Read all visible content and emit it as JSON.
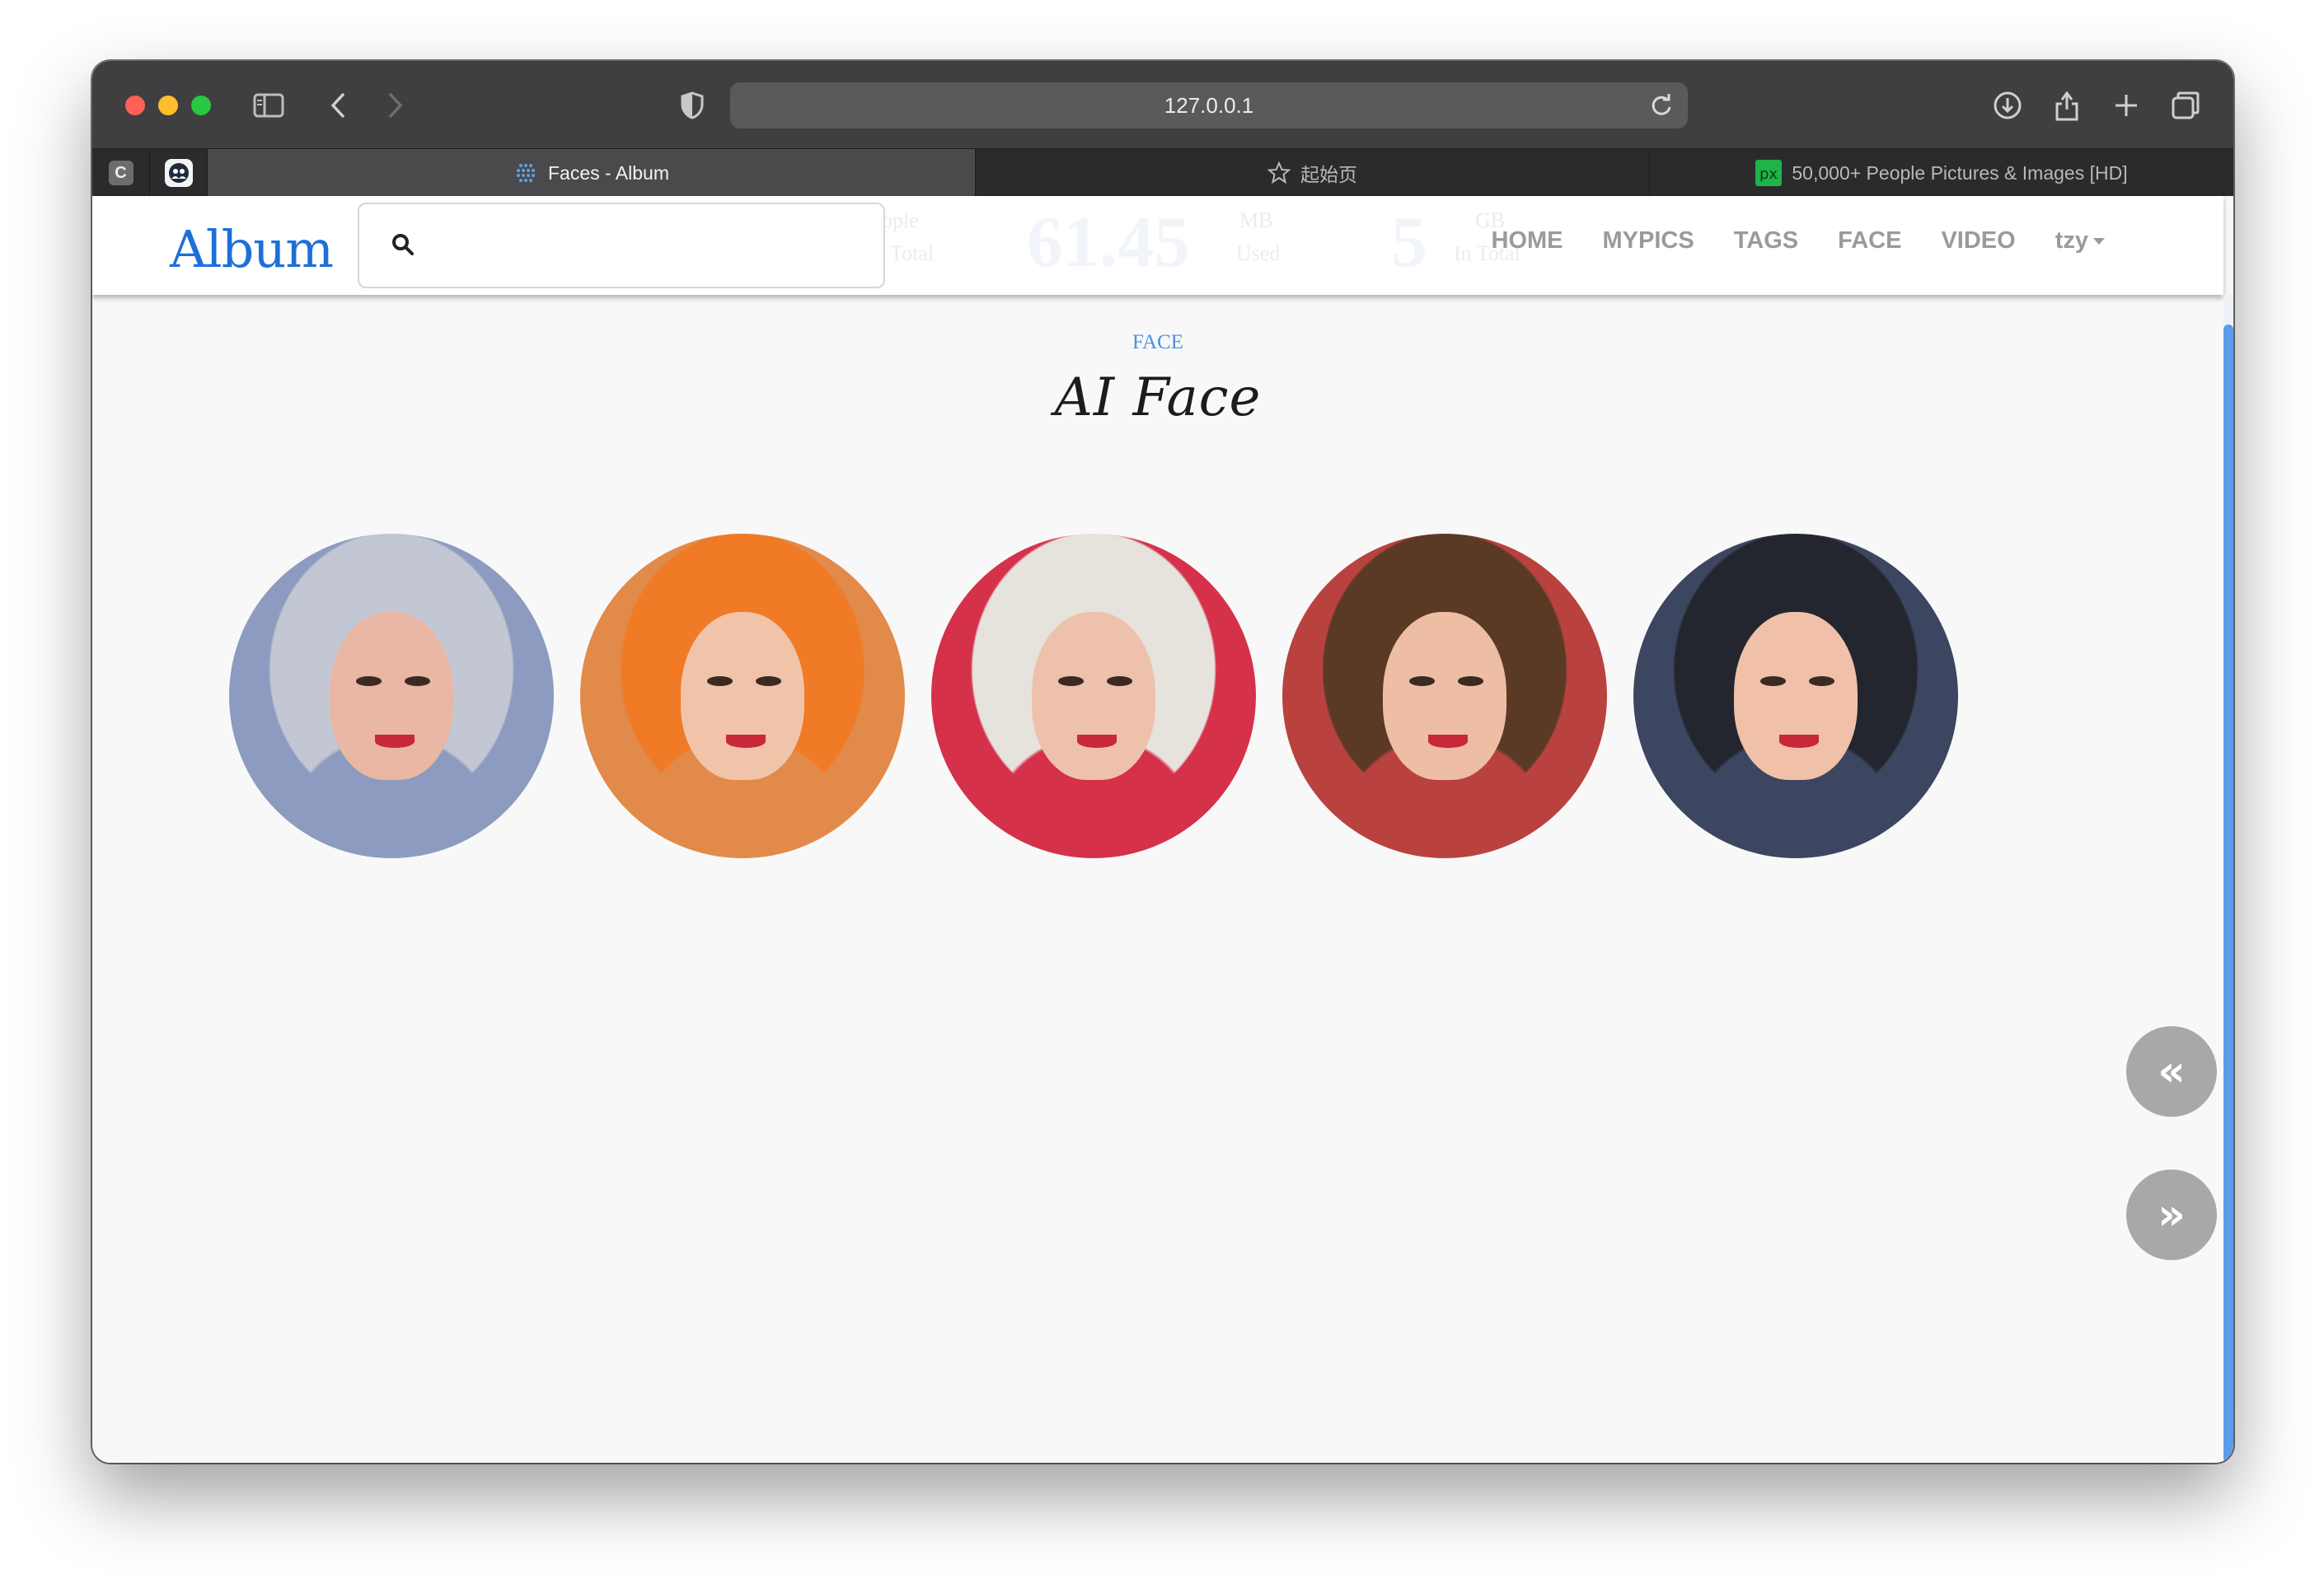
{
  "browser": {
    "url": "127.0.0.1",
    "tabs": [
      {
        "title": "Faces - Album",
        "active": true,
        "favicon": "grid-dots-icon"
      },
      {
        "title": "起始页",
        "active": false,
        "favicon": "star-icon"
      },
      {
        "title": "50,000+ People Pictures & Images [HD]",
        "active": false,
        "favicon": "px-logo-icon"
      }
    ],
    "pinned": [
      {
        "label": "C",
        "icon": "c-letter-icon"
      },
      {
        "label": "",
        "icon": "people-app-icon"
      }
    ]
  },
  "navbar": {
    "logo": "Album",
    "search_placeholder": "",
    "links": [
      "HOME",
      "MYPICS",
      "TAGS",
      "FACE",
      "VIDEO"
    ],
    "user": "tzy"
  },
  "ghost_stats": {
    "people_label_1": "ople",
    "people_label_2": "Total",
    "mb_value": "61.45",
    "mb_label_1": "MB",
    "mb_label_2": "Used",
    "gb_value": "5",
    "gb_label_1": "GB",
    "gb_label_2": "In Total"
  },
  "section": {
    "eyebrow": "FACE",
    "title": "AI Face"
  },
  "faces": [
    {
      "name": "face-1",
      "hair": "#c3c7d4",
      "skin": "#e9b7a3",
      "bg": "#8c9bbf"
    },
    {
      "name": "face-2",
      "hair": "#f07a26",
      "skin": "#f1c4aa",
      "bg": "#e28a4a"
    },
    {
      "name": "face-3",
      "hair": "#e6e2dc",
      "skin": "#eec1ad",
      "bg": "#d5314a"
    },
    {
      "name": "face-4",
      "hair": "#5a3a25",
      "skin": "#eebea4",
      "bg": "#b9423f"
    },
    {
      "name": "face-5",
      "hair": "#23262f",
      "skin": "#f0c1a8",
      "bg": "#3d4660"
    }
  ],
  "pager": {
    "prev": "«",
    "next": "»"
  },
  "colors": {
    "accent": "#1e6fd9",
    "eyebrow": "#4a90e2",
    "scroll": "#5d9cec"
  }
}
